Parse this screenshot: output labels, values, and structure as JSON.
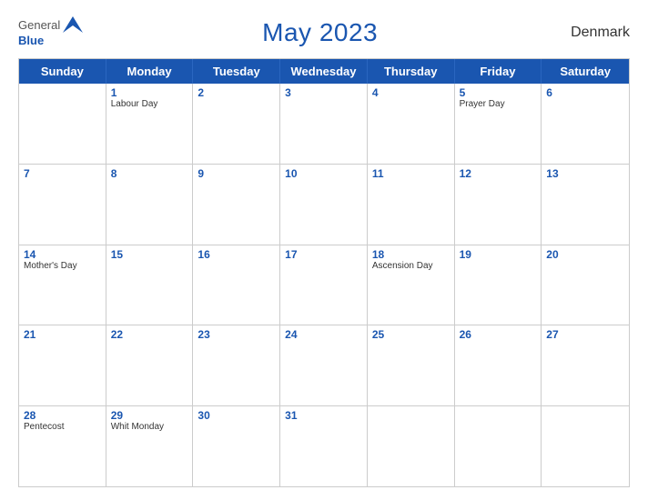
{
  "header": {
    "logo_general": "General",
    "logo_blue": "Blue",
    "title": "May 2023",
    "country": "Denmark"
  },
  "day_headers": [
    "Sunday",
    "Monday",
    "Tuesday",
    "Wednesday",
    "Thursday",
    "Friday",
    "Saturday"
  ],
  "weeks": [
    [
      {
        "day": "",
        "holiday": ""
      },
      {
        "day": "1",
        "holiday": "Labour Day"
      },
      {
        "day": "2",
        "holiday": ""
      },
      {
        "day": "3",
        "holiday": ""
      },
      {
        "day": "4",
        "holiday": ""
      },
      {
        "day": "5",
        "holiday": "Prayer Day"
      },
      {
        "day": "6",
        "holiday": ""
      }
    ],
    [
      {
        "day": "7",
        "holiday": ""
      },
      {
        "day": "8",
        "holiday": ""
      },
      {
        "day": "9",
        "holiday": ""
      },
      {
        "day": "10",
        "holiday": ""
      },
      {
        "day": "11",
        "holiday": ""
      },
      {
        "day": "12",
        "holiday": ""
      },
      {
        "day": "13",
        "holiday": ""
      }
    ],
    [
      {
        "day": "14",
        "holiday": "Mother's Day"
      },
      {
        "day": "15",
        "holiday": ""
      },
      {
        "day": "16",
        "holiday": ""
      },
      {
        "day": "17",
        "holiday": ""
      },
      {
        "day": "18",
        "holiday": "Ascension Day"
      },
      {
        "day": "19",
        "holiday": ""
      },
      {
        "day": "20",
        "holiday": ""
      }
    ],
    [
      {
        "day": "21",
        "holiday": ""
      },
      {
        "day": "22",
        "holiday": ""
      },
      {
        "day": "23",
        "holiday": ""
      },
      {
        "day": "24",
        "holiday": ""
      },
      {
        "day": "25",
        "holiday": ""
      },
      {
        "day": "26",
        "holiday": ""
      },
      {
        "day": "27",
        "holiday": ""
      }
    ],
    [
      {
        "day": "28",
        "holiday": "Pentecost"
      },
      {
        "day": "29",
        "holiday": "Whit Monday"
      },
      {
        "day": "30",
        "holiday": ""
      },
      {
        "day": "31",
        "holiday": ""
      },
      {
        "day": "",
        "holiday": ""
      },
      {
        "day": "",
        "holiday": ""
      },
      {
        "day": "",
        "holiday": ""
      }
    ]
  ]
}
